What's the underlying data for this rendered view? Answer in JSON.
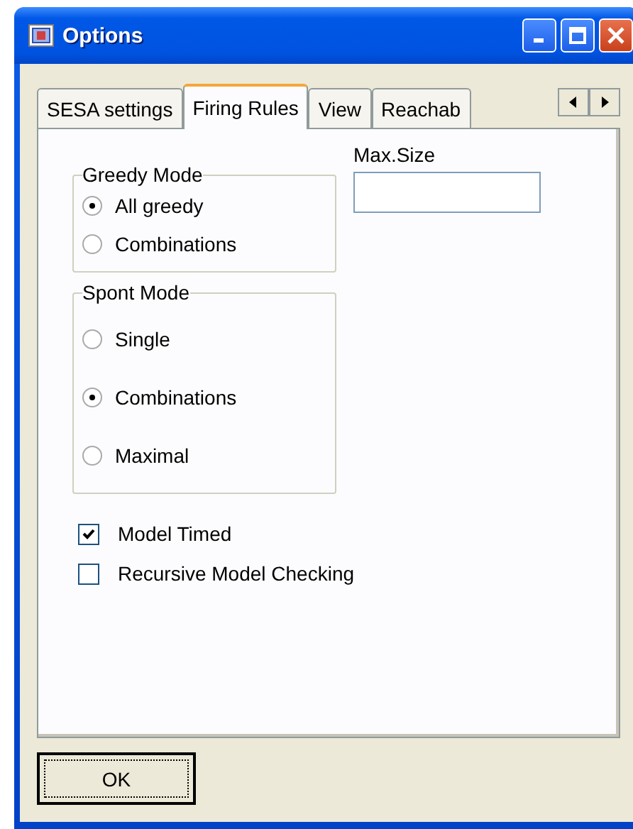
{
  "window": {
    "title": "Options"
  },
  "tabs": [
    {
      "label": "SESA settings",
      "selected": false
    },
    {
      "label": "Firing Rules",
      "selected": true
    },
    {
      "label": "View",
      "selected": false
    },
    {
      "label": "Reachab",
      "selected": false
    }
  ],
  "greedy_mode": {
    "title": "Greedy Mode",
    "options": [
      {
        "label": "All greedy",
        "selected": true
      },
      {
        "label": "Combinations",
        "selected": false
      }
    ]
  },
  "spont_mode": {
    "title": "Spont Mode",
    "options": [
      {
        "label": "Single",
        "selected": false
      },
      {
        "label": "Combinations",
        "selected": true
      },
      {
        "label": "Maximal",
        "selected": false
      }
    ]
  },
  "max_size": {
    "label": "Max.Size"
  },
  "checkboxes": [
    {
      "label": "Model Timed",
      "checked": true
    },
    {
      "label": "Recursive Model Checking",
      "checked": false
    }
  ],
  "buttons": [
    {
      "label": "OK"
    }
  ]
}
